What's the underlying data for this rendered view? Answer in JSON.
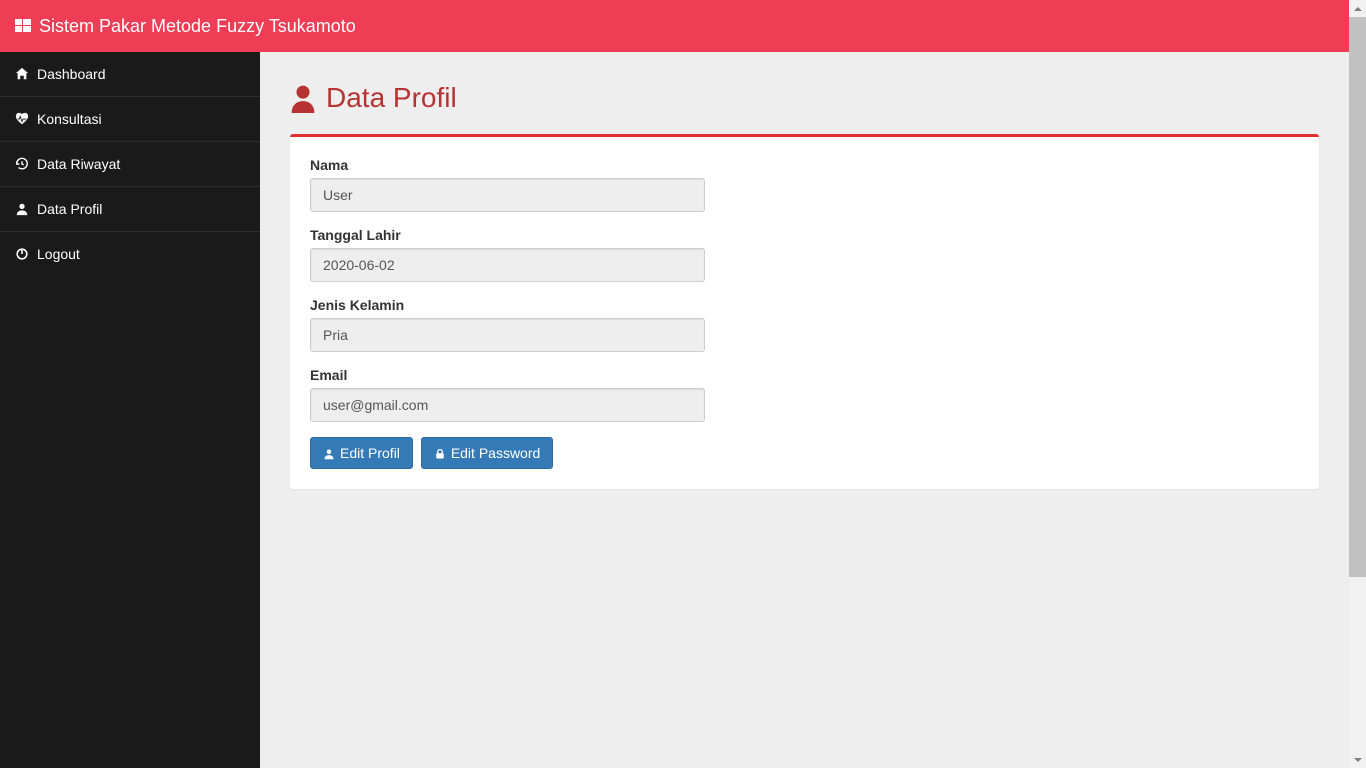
{
  "colors": {
    "topbar": "#ef3d55",
    "sidebar": "#1a1a1a",
    "accent": "#b73333",
    "primary_btn": "#337ab7"
  },
  "brand": {
    "title": "Sistem Pakar Metode Fuzzy Tsukamoto",
    "icon": "windows-icon"
  },
  "sidebar": {
    "items": [
      {
        "icon": "home-icon",
        "label": "Dashboard"
      },
      {
        "icon": "heartbeat-icon",
        "label": "Konsultasi"
      },
      {
        "icon": "history-icon",
        "label": "Data Riwayat"
      },
      {
        "icon": "user-icon",
        "label": "Data Profil"
      },
      {
        "icon": "power-icon",
        "label": "Logout"
      }
    ]
  },
  "page": {
    "title": "Data Profil",
    "title_icon": "user-icon",
    "fields": {
      "nama": {
        "label": "Nama",
        "value": "User"
      },
      "tgl": {
        "label": "Tanggal Lahir",
        "value": "2020-06-02"
      },
      "jk": {
        "label": "Jenis Kelamin",
        "value": "Pria"
      },
      "email": {
        "label": "Email",
        "value": "user@gmail.com"
      }
    },
    "buttons": {
      "edit_profile": {
        "icon": "user-icon",
        "label": "Edit Profil"
      },
      "edit_password": {
        "icon": "lock-icon",
        "label": "Edit Password"
      }
    }
  }
}
